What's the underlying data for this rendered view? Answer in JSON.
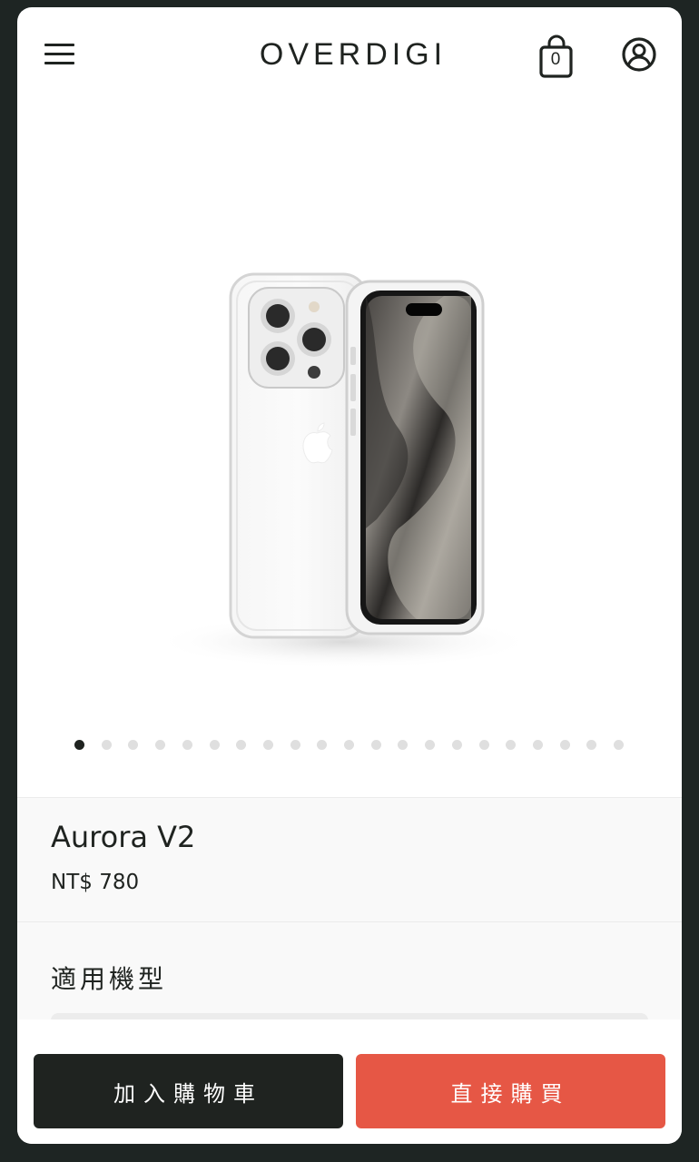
{
  "header": {
    "logo": "OVERDIGI",
    "cart_count": "0",
    "icons": {
      "menu": "hamburger-menu-icon",
      "cart": "shopping-bag-icon",
      "account": "user-account-icon"
    }
  },
  "gallery": {
    "image_alt": "iPhone clear case product photo",
    "slide_count": 21,
    "active_slide": 1
  },
  "product": {
    "name": "Aurora V2",
    "price": "NT$ 780",
    "model_label": "適用機型"
  },
  "actions": {
    "add_to_cart": "加入購物車",
    "buy_now": "直接購買"
  },
  "colors": {
    "frame": "#1e2523",
    "text": "#1f2320",
    "buy_button": "#e65745",
    "cart_button": "#1f2320"
  }
}
